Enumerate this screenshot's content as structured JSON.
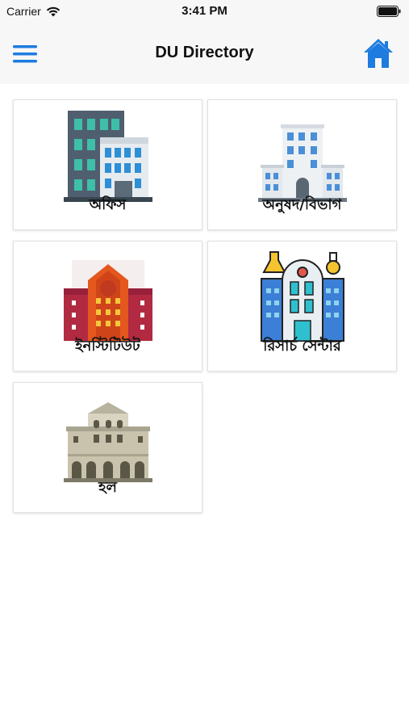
{
  "status": {
    "carrier": "Carrier",
    "time": "3:41 PM"
  },
  "nav": {
    "title": "DU Directory",
    "menu_icon": "hamburger-menu-icon",
    "home_icon": "home-icon"
  },
  "colors": {
    "accent": "#1e7be0",
    "nav_bg": "#f7f7f7"
  },
  "grid": {
    "items": [
      {
        "label": "অফিস",
        "icon": "office-building-icon"
      },
      {
        "label": "অনুষদ/বিভাগ",
        "icon": "faculty-building-icon"
      },
      {
        "label": "ইনস্টিটিউট",
        "icon": "institute-building-icon"
      },
      {
        "label": "রিসার্চ সেন্টার",
        "icon": "research-center-icon"
      },
      {
        "label": "হল",
        "icon": "hall-building-icon"
      }
    ]
  }
}
